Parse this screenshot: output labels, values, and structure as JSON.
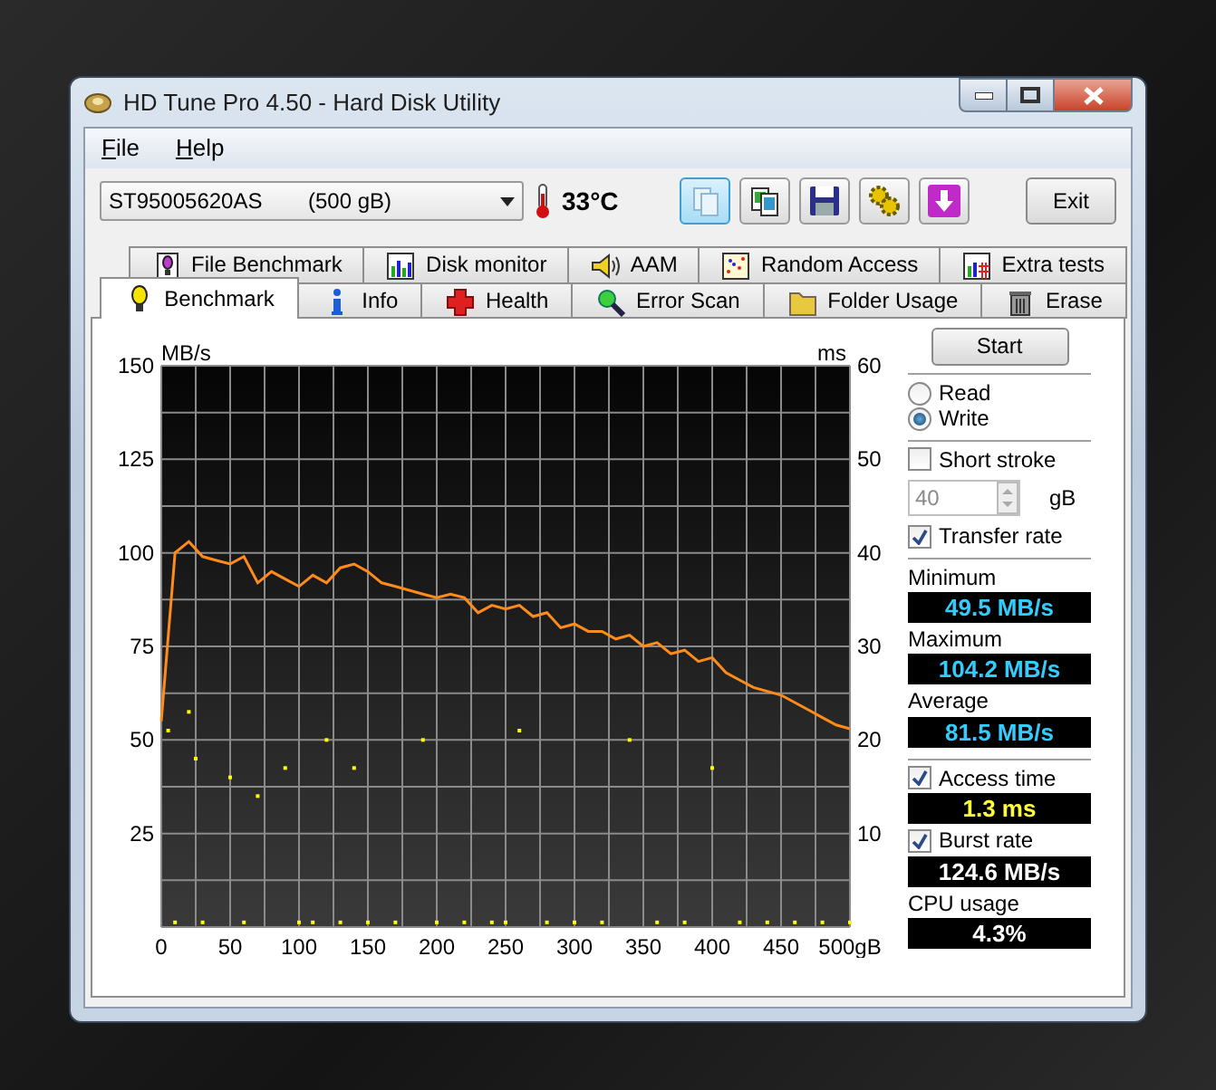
{
  "window": {
    "title": "HD Tune Pro 4.50 - Hard Disk Utility"
  },
  "menu": [
    "File",
    "Help"
  ],
  "toolbar": {
    "drive": {
      "model": "ST95005620AS",
      "capacity": "(500 gB)"
    },
    "temperature": "33°C",
    "tools": [
      {
        "kind": "copy",
        "selected": true
      },
      {
        "kind": "documents",
        "selected": false
      },
      {
        "kind": "floppy",
        "selected": false
      },
      {
        "kind": "gears",
        "selected": false
      },
      {
        "kind": "download",
        "selected": false
      }
    ],
    "exit": "Exit"
  },
  "tabs": [
    [
      {
        "label": "File Benchmark",
        "kind": "file",
        "selected": false
      },
      {
        "label": "Disk monitor",
        "kind": "monitor",
        "selected": false
      },
      {
        "label": "AAM",
        "kind": "speaker",
        "selected": false
      },
      {
        "label": "Random Access",
        "kind": "dots",
        "selected": false
      },
      {
        "label": "Extra tests",
        "kind": "grid",
        "selected": false
      }
    ],
    [
      {
        "label": "Benchmark",
        "kind": "bulb",
        "selected": true
      },
      {
        "label": "Info",
        "kind": "info",
        "selected": false
      },
      {
        "label": "Health",
        "kind": "cross",
        "selected": false
      },
      {
        "label": "Error Scan",
        "kind": "magnifier",
        "selected": false
      },
      {
        "label": "Folder Usage",
        "kind": "folder",
        "selected": false
      },
      {
        "label": "Erase",
        "kind": "trash",
        "selected": false
      }
    ]
  ],
  "benchmark": {
    "transfer_chart": {
      "chart_data": {
        "type": "line",
        "ylabel": "MB/s",
        "grid": true,
        "x": [
          0,
          10,
          20,
          30,
          40,
          50,
          60,
          70,
          80,
          90,
          100,
          110,
          120,
          130,
          140,
          150,
          160,
          170,
          180,
          190,
          200,
          210,
          220,
          230,
          240,
          250,
          260,
          270,
          280,
          290,
          300,
          310,
          320,
          330,
          340,
          350,
          360,
          370,
          380,
          390,
          400,
          410,
          420,
          430,
          440,
          450,
          460,
          470,
          480,
          490,
          500
        ],
        "series": [
          {
            "color": "#ff8c1a",
            "values": [
              55,
              100,
              103,
              99,
              98,
              97,
              99,
              92,
              95,
              93,
              91,
              94,
              92,
              96,
              97,
              95,
              92,
              91,
              90,
              89,
              88,
              89,
              88,
              84,
              86,
              85,
              86,
              83,
              84,
              80,
              81,
              79,
              79,
              77,
              78,
              75,
              76,
              73,
              74,
              71,
              72,
              68,
              66,
              64,
              63,
              62,
              60,
              58,
              56,
              54,
              53
            ]
          }
        ],
        "xlim": [
          0,
          500
        ],
        "ylim": [
          0,
          150
        ],
        "xticks": [
          0,
          50,
          100,
          150,
          200,
          250,
          300,
          350,
          400,
          450,
          {
            "value": 500,
            "label": "500gB"
          }
        ],
        "yticks": [
          150,
          125,
          100,
          75,
          50,
          25
        ]
      }
    },
    "access_chart": {
      "chart_data": {
        "type": "scatter",
        "ylabel": "ms",
        "color": "#ffff00",
        "x": [
          5,
          10,
          20,
          25,
          30,
          50,
          60,
          70,
          90,
          100,
          110,
          120,
          130,
          140,
          150,
          170,
          190,
          200,
          220,
          240,
          250,
          260,
          280,
          300,
          320,
          340,
          360,
          380,
          400,
          420,
          440,
          460,
          480,
          500
        ],
        "values": [
          21,
          0.5,
          23,
          18,
          0.5,
          16,
          0.5,
          14,
          17,
          0.5,
          0.5,
          20,
          0.5,
          17,
          0.5,
          0.5,
          20,
          0.5,
          0.5,
          0.5,
          0.5,
          21,
          0.5,
          0.5,
          0.5,
          20,
          0.5,
          0.5,
          17,
          0.5,
          0.5,
          0.5,
          0.5,
          0.5
        ],
        "xlim": [
          0,
          500
        ],
        "ylim": [
          0,
          60
        ],
        "yticks": [
          60,
          50,
          40,
          30,
          20,
          10
        ]
      }
    },
    "start": "Start",
    "modes": [
      {
        "label": "Read",
        "selected": false
      },
      {
        "label": "Write",
        "selected": true
      }
    ],
    "short_stroke": {
      "label": "Short stroke",
      "checked": false,
      "value": "40",
      "unit": "gB",
      "disabled": true
    },
    "transfer_rate": {
      "label": "Transfer rate",
      "checked": true
    },
    "readout_groups": [
      [
        {
          "kind": "label",
          "label": "Minimum",
          "value": "49.5 MB/s",
          "color": "#33ccff"
        },
        {
          "kind": "label",
          "label": "Maximum",
          "value": "104.2 MB/s",
          "color": "#33ccff"
        },
        {
          "kind": "label",
          "label": "Average",
          "value": "81.5 MB/s",
          "color": "#33ccff"
        }
      ],
      [
        {
          "kind": "check",
          "label": "Access time",
          "checked": true,
          "value": "1.3 ms",
          "color": "#ffff33"
        },
        {
          "kind": "check",
          "label": "Burst rate",
          "checked": true,
          "value": "124.6 MB/s",
          "color": "#ffffff"
        },
        {
          "kind": "label",
          "label": "CPU usage",
          "value": "4.3%",
          "color": "#ffffff"
        }
      ]
    ]
  }
}
